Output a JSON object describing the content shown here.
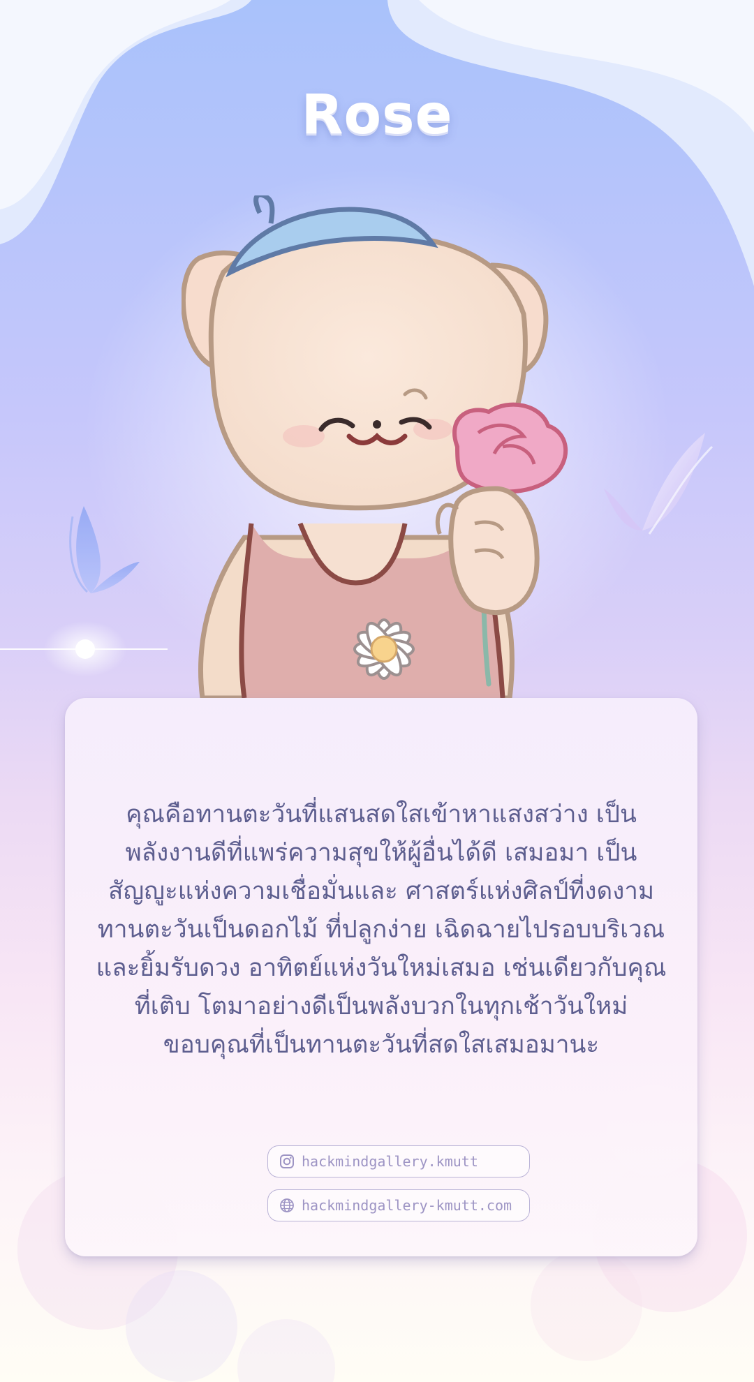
{
  "title": "Rose",
  "message": "คุณคือทานตะวันที่แสนสดใสเข้าหาแสงสว่าง เป็นพลังงานดีที่แพร่ความสุขให้ผู้อื่นได้ดี เสมอมา เป็นสัญญูะแห่งความเชื่อมั่นและ ศาสตร์แห่งศิลป์ที่งดงาม ทานตะวันเป็นดอกไม้ ที่ปลูกง่าย เฉิดฉายไปรอบบริเวณและยิ้มรับดวง อาทิตย์แห่งวันใหม่เสมอ เช่นเดียวกับคุณที่เติบ โตมาอย่างดีเป็นพลังบวกในทุกเช้าวันใหม่ ขอบคุณที่เป็นทานตะวันที่สดใสเสมอมานะ",
  "links": {
    "instagram": {
      "icon": "instagram-icon",
      "label": "hackmindgallery.kmutt"
    },
    "website": {
      "icon": "globe-icon",
      "label": "hackmindgallery-kmutt.com"
    }
  },
  "colors": {
    "sky_top": "#a9c2fb",
    "lavender": "#d9cff8",
    "pink": "#f8e6f5",
    "text": "#5d5e8f",
    "link_text": "#9d94c4"
  }
}
